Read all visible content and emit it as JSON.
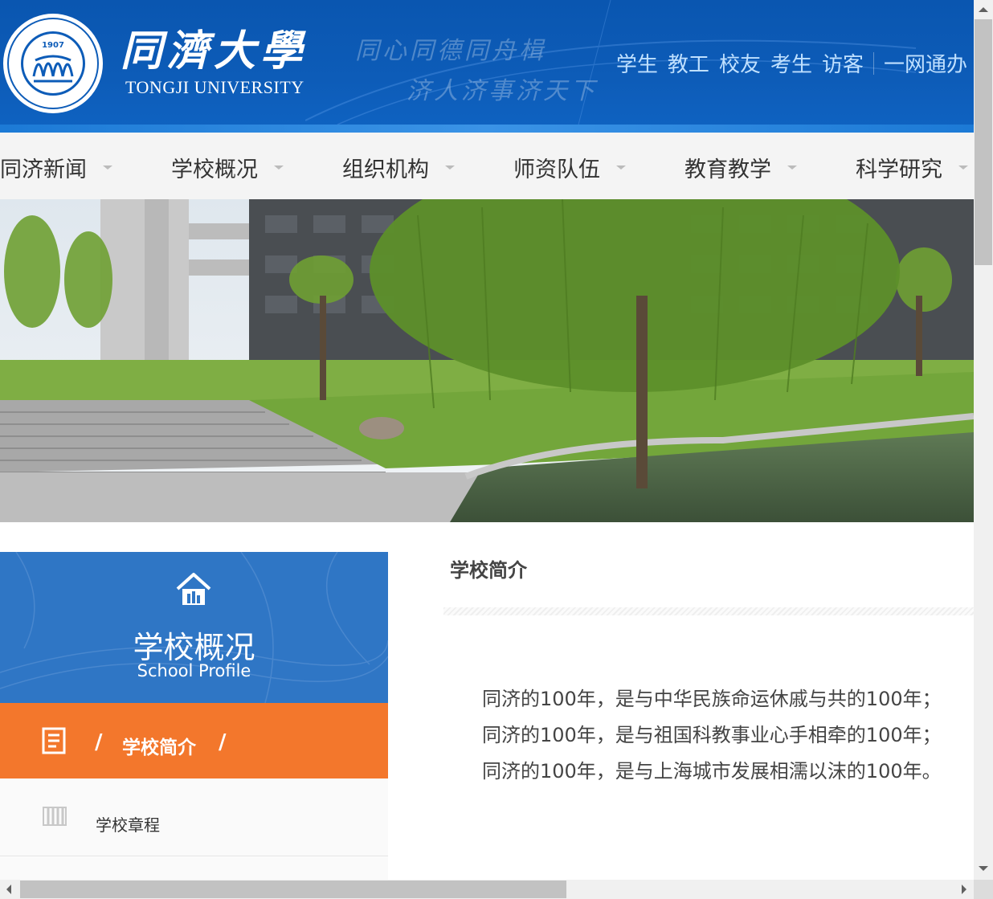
{
  "header": {
    "logo_cn": "同濟大學",
    "logo_en": "TONGJI UNIVERSITY",
    "seal_year": "1907",
    "motto_line1": "同心同德同舟楫",
    "motto_line2": "济人济事济天下",
    "top_links": [
      "学生",
      "教工",
      "校友",
      "考生",
      "访客"
    ],
    "portal_link": "一网通办"
  },
  "nav": {
    "items": [
      "同济新闻",
      "学校概况",
      "组织机构",
      "师资队伍",
      "教育教学",
      "科学研究"
    ]
  },
  "sidebar": {
    "title": "学校概况",
    "subtitle": "School Profile",
    "active_item": {
      "label": "学校简介",
      "slash": "/"
    },
    "items": [
      {
        "label": "学校章程"
      }
    ]
  },
  "main": {
    "title": "学校简介",
    "paragraphs": [
      "同济的100年，是与中华民族命运休戚与共的100年；",
      "同济的100年，是与祖国科教事业心手相牵的100年；",
      "同济的100年，是与上海城市发展相濡以沫的100年。"
    ]
  },
  "colors": {
    "header_blue": "#0d5cb8",
    "top_link_color": "#bfe0ff",
    "nav_bg": "#f4f4f4",
    "sidebar_blue": "#2f76c5",
    "sidebar_active_orange": "#f3772c",
    "text_dark": "#444444"
  },
  "icons": {
    "seal": "tongji-seal-icon",
    "home": "home-icon",
    "active_item": "document-icon",
    "charter": "charter-icon",
    "nav_caret": "caret-down-icon"
  }
}
